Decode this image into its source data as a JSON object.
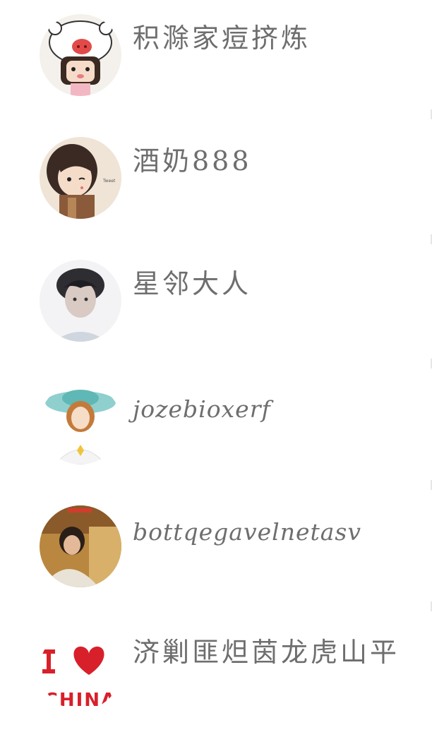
{
  "contacts": [
    {
      "name": "积滁家痘挤炼",
      "avatar_icon": "cartoon-pig-hat-avatar-icon"
    },
    {
      "name": "酒奶888",
      "avatar_icon": "anime-girl-avatar-icon"
    },
    {
      "name": "星邻大人",
      "avatar_icon": "person-photo-avatar-icon"
    },
    {
      "name": "jozebioxerf",
      "avatar_icon": "girl-with-hat-avatar-icon"
    },
    {
      "name": "bottqegavelnetasv",
      "avatar_icon": "person-photo-avatar-icon"
    },
    {
      "name": "济剿匪炟茵龙虎山平",
      "avatar_icon": "i-love-china-avatar-icon"
    }
  ],
  "avatar_badge_text": "CHINA",
  "colors": {
    "name_text": "#6e6e6e",
    "background": "#ffffff",
    "heart": "#d8202a"
  }
}
